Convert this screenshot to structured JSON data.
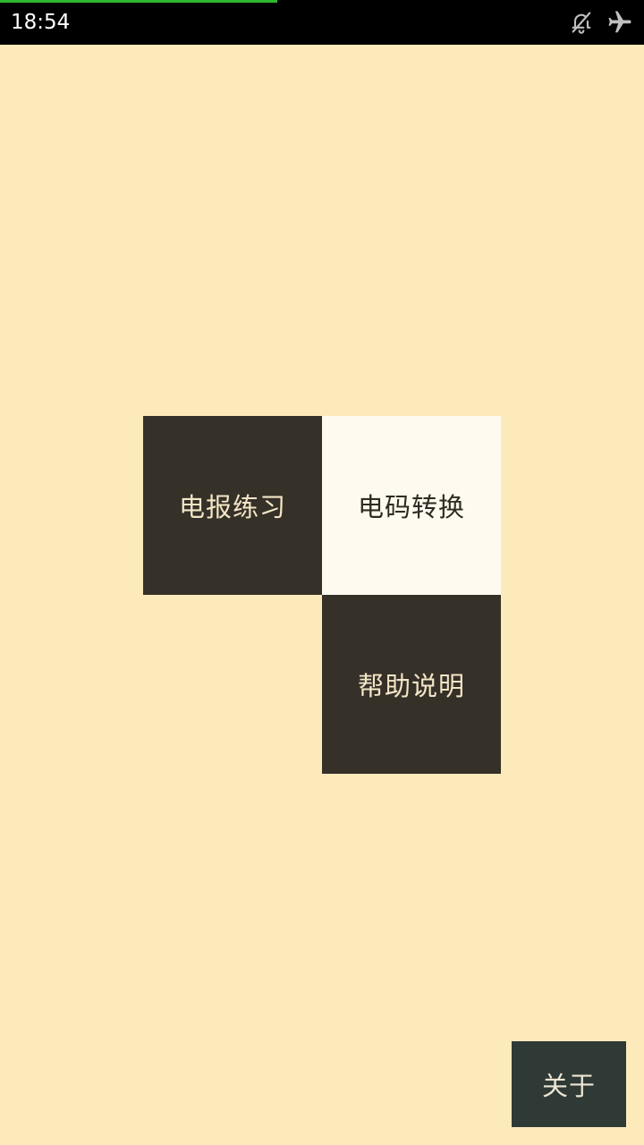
{
  "status_bar": {
    "time": "18:54",
    "progress_fraction": 0.43,
    "icons": [
      "bell-off-icon",
      "airplane-icon"
    ]
  },
  "menu": {
    "practice_label": "电报练习",
    "convert_label": "电码转换",
    "help_label": "帮助说明"
  },
  "about": {
    "label": "关于"
  },
  "colors": {
    "background": "#FDEABB",
    "tile_dark": "#353028",
    "tile_light": "#FFFAEF",
    "about_button": "#2F3A36",
    "progress": "#2EB82E"
  }
}
